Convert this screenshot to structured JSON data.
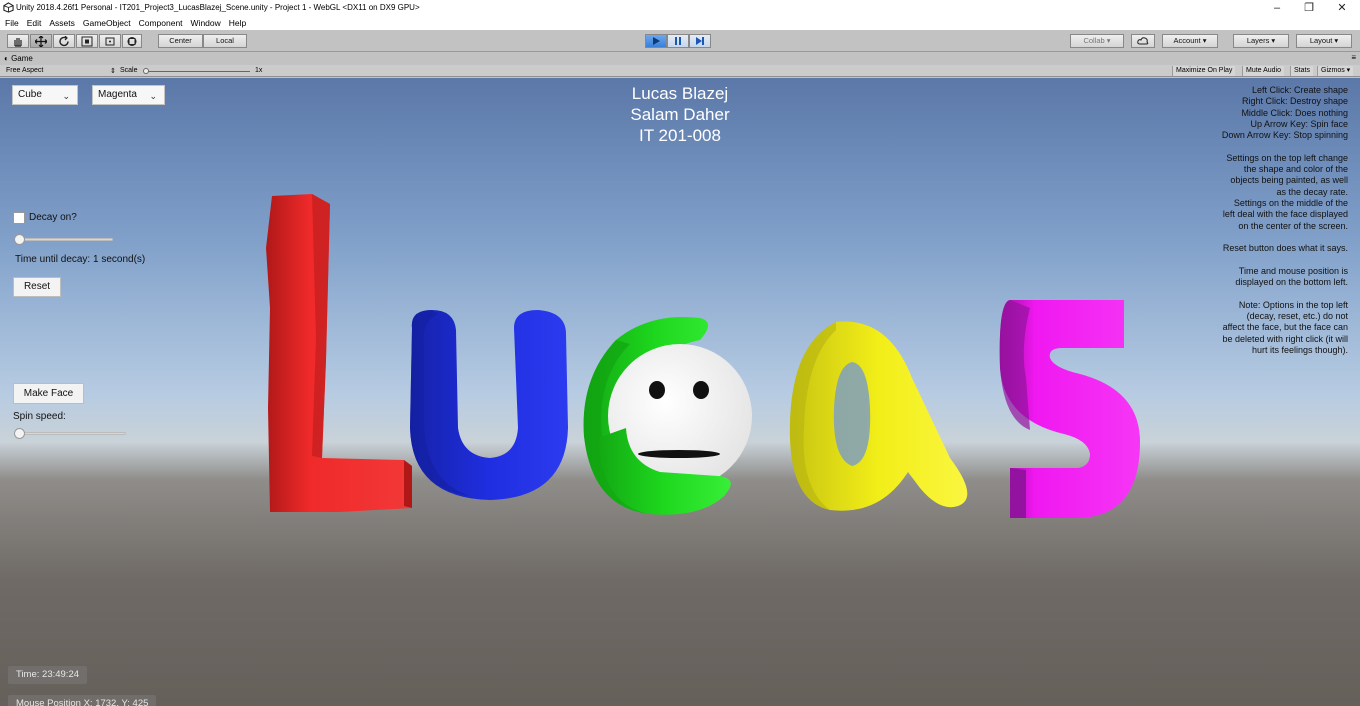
{
  "window": {
    "title": "Unity 2018.4.26f1 Personal - IT201_Project3_LucasBlazej_Scene.unity - Project 1 - WebGL <DX11 on DX9 GPU>",
    "minimize": "–",
    "maximize": "❐",
    "close": "✕"
  },
  "menu": [
    "File",
    "Edit",
    "Assets",
    "GameObject",
    "Component",
    "Window",
    "Help"
  ],
  "toolbar": {
    "pivot": "Center",
    "space": "Local",
    "collab": "Collab ▾",
    "account": "Account ▾",
    "layers": "Layers ▾",
    "layout": "Layout ▾"
  },
  "game_tab": {
    "label": "Game",
    "aspect": "Free Aspect",
    "scale_label": "Scale",
    "scale_value": "1x",
    "maximize_on_play": "Maximize On Play",
    "mute_audio": "Mute Audio",
    "stats": "Stats",
    "gizmos": "Gizmos ▾"
  },
  "game_ui": {
    "shape_dropdown": "Cube",
    "color_dropdown": "Magenta",
    "credits": [
      "Lucas Blazej",
      "Salam Daher",
      "IT 201-008"
    ],
    "decay_label": "Decay on?",
    "decay_checked": false,
    "decay_slider_value": 0,
    "decay_text": "Time until decay: 1 second(s)",
    "reset_button": "Reset",
    "make_face_button": "Make Face",
    "spin_label": "Spin speed:",
    "spin_slider_value": 0,
    "time_text": "Time: 23:49:24",
    "mouse_text": "Mouse Position X: 1732, Y: 425",
    "help_lines": [
      "Left Click: Create shape",
      "Right Click: Destroy shape",
      "Middle Click: Does nothing",
      "Up Arrow Key: Spin face",
      "Down Arrow Key: Stop spinning",
      "",
      "Settings on the top left change",
      "the shape and color of the",
      "objects being painted, as well",
      "as the decay rate.",
      "Settings on the middle of the",
      "left deal with the face displayed",
      "on the center of the screen.",
      "",
      "Reset button does what it says.",
      "",
      "Time and mouse position is",
      "displayed on the bottom left.",
      "",
      "Note: Options in the top left",
      "(decay, reset, etc.) do not",
      "affect the face, but the face can",
      "be deleted with right click (it will",
      "hurt its feelings though)."
    ]
  },
  "scene": {
    "letter_colors": {
      "L": "#f02a2a",
      "u": "#1f2ee0",
      "c": "#1ed81e",
      "a": "#f2ee18",
      "s": "#f018f0"
    },
    "face_color": "#ffffff"
  }
}
